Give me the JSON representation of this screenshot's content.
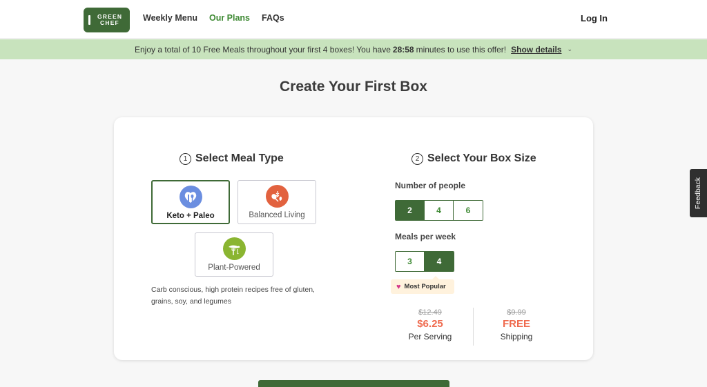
{
  "header": {
    "logo_line1": "GREEN",
    "logo_line2": "CHEF",
    "nav": [
      {
        "label": "Weekly Menu",
        "active": false
      },
      {
        "label": "Our Plans",
        "active": true
      },
      {
        "label": "FAQs",
        "active": false
      }
    ],
    "login_label": "Log In"
  },
  "promo": {
    "text_before": "Enjoy a total of 10 Free Meals throughout your first 4 boxes! You have",
    "timer": "28:58",
    "text_after": "minutes to use this offer!",
    "show_details_label": "Show details",
    "chevron_icon": "chevron-down-icon"
  },
  "page_title": "Create Your First Box",
  "meal_type": {
    "step_number": "1",
    "title": "Select Meal Type",
    "options": [
      {
        "label": "Keto + Paleo",
        "icon": "keto-utensils-icon",
        "color": "#6b8ee0",
        "selected": true
      },
      {
        "label": "Balanced Living",
        "icon": "balanced-food-icon",
        "color": "#e2623f",
        "selected": false
      },
      {
        "label": "Plant-Powered",
        "icon": "plant-fork-icon",
        "color": "#8ab531",
        "selected": false
      }
    ],
    "description": "Carb conscious, high protein recipes free of gluten, grains, soy, and legumes"
  },
  "box_size": {
    "step_number": "2",
    "title": "Select Your Box Size",
    "people_label": "Number of people",
    "people_options": [
      "2",
      "4",
      "6"
    ],
    "people_selected": "2",
    "meals_label": "Meals per week",
    "meals_options": [
      "3",
      "4"
    ],
    "meals_selected": "4",
    "popular_badge": "Most Popular"
  },
  "pricing": {
    "serving_original": "$12.49",
    "serving_price": "$6.25",
    "serving_label": "Per Serving",
    "shipping_original": "$9.99",
    "shipping_price": "FREE",
    "shipping_label": "Shipping"
  },
  "feedback_label": "Feedback",
  "colors": {
    "brand_green": "#3f6a37",
    "nav_active": "#3f8a34",
    "promo_bg": "#c8e3bd",
    "price_accent": "#ef6a4e"
  }
}
